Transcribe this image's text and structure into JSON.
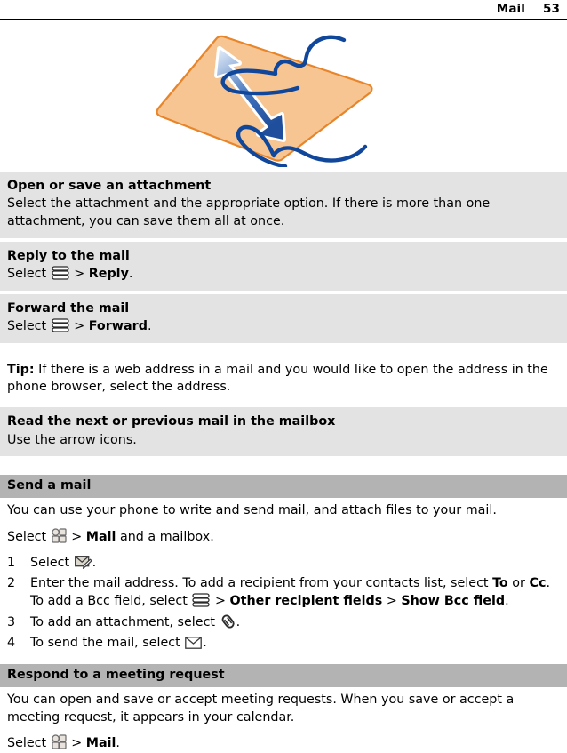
{
  "header": {
    "title": "Mail",
    "page_number": "53"
  },
  "figure": {
    "name": "pinch-zoom-gesture-illustration",
    "colors": {
      "device_fill": "#f6c592",
      "device_border": "#e8852a",
      "arrow_light": "#8fb4de",
      "arrow_dark": "#1f4e9c",
      "hand_outline": "#11479b"
    }
  },
  "icons": {
    "menu": "menu-icon",
    "apps_grid": "apps-grid-icon",
    "new_message": "new-message-envelope-icon",
    "attachment": "paperclip-icon",
    "send": "send-envelope-icon"
  },
  "blocks": [
    {
      "title": "Open or save an attachment",
      "body": "Select the attachment and the appropriate option. If there is more than one attachment, you can save them all at once."
    },
    {
      "title": "Reply to the mail",
      "select_label": "Select",
      "separator": ">",
      "target": "Reply",
      "trailing": "."
    },
    {
      "title": "Forward the mail",
      "select_label": "Select",
      "separator": ">",
      "target": "Forward",
      "trailing": "."
    }
  ],
  "tip": {
    "label": "Tip:",
    "text": " If there is a web address in a mail and you would like to open the address in the phone browser, select the address."
  },
  "read_block": {
    "title": "Read the next or previous mail in the mailbox",
    "body": "Use the arrow icons."
  },
  "send_section": {
    "heading": "Send a mail",
    "intro": "You can use your phone to write and send mail, and attach files to your mail.",
    "select_line": {
      "select_label": "Select",
      "separator": ">",
      "target": "Mail",
      "suffix": " and a mailbox."
    },
    "steps": [
      {
        "num": "1",
        "pre": "Select ",
        "post": "."
      },
      {
        "num": "2",
        "pre": "Enter the mail address. To add a recipient from your contacts list, select ",
        "bold1": "To",
        "mid1": " or ",
        "bold2": "Cc",
        "mid2": ". To add a Bcc field, select ",
        "sep1": ">",
        "bold3": "Other recipient fields",
        "sep2": ">",
        "bold4": "Show Bcc field",
        "post": "."
      },
      {
        "num": "3",
        "pre": "To add an attachment, select ",
        "post": "."
      },
      {
        "num": "4",
        "pre": "To send the mail, select ",
        "post": "."
      }
    ]
  },
  "meeting_section": {
    "heading": "Respond to a meeting request",
    "intro": "You can open and save or accept meeting requests. When you save or accept a meeting request, it appears in your calendar.",
    "select_line": {
      "select_label": "Select",
      "separator": ">",
      "target": "Mail",
      "suffix": "."
    }
  }
}
